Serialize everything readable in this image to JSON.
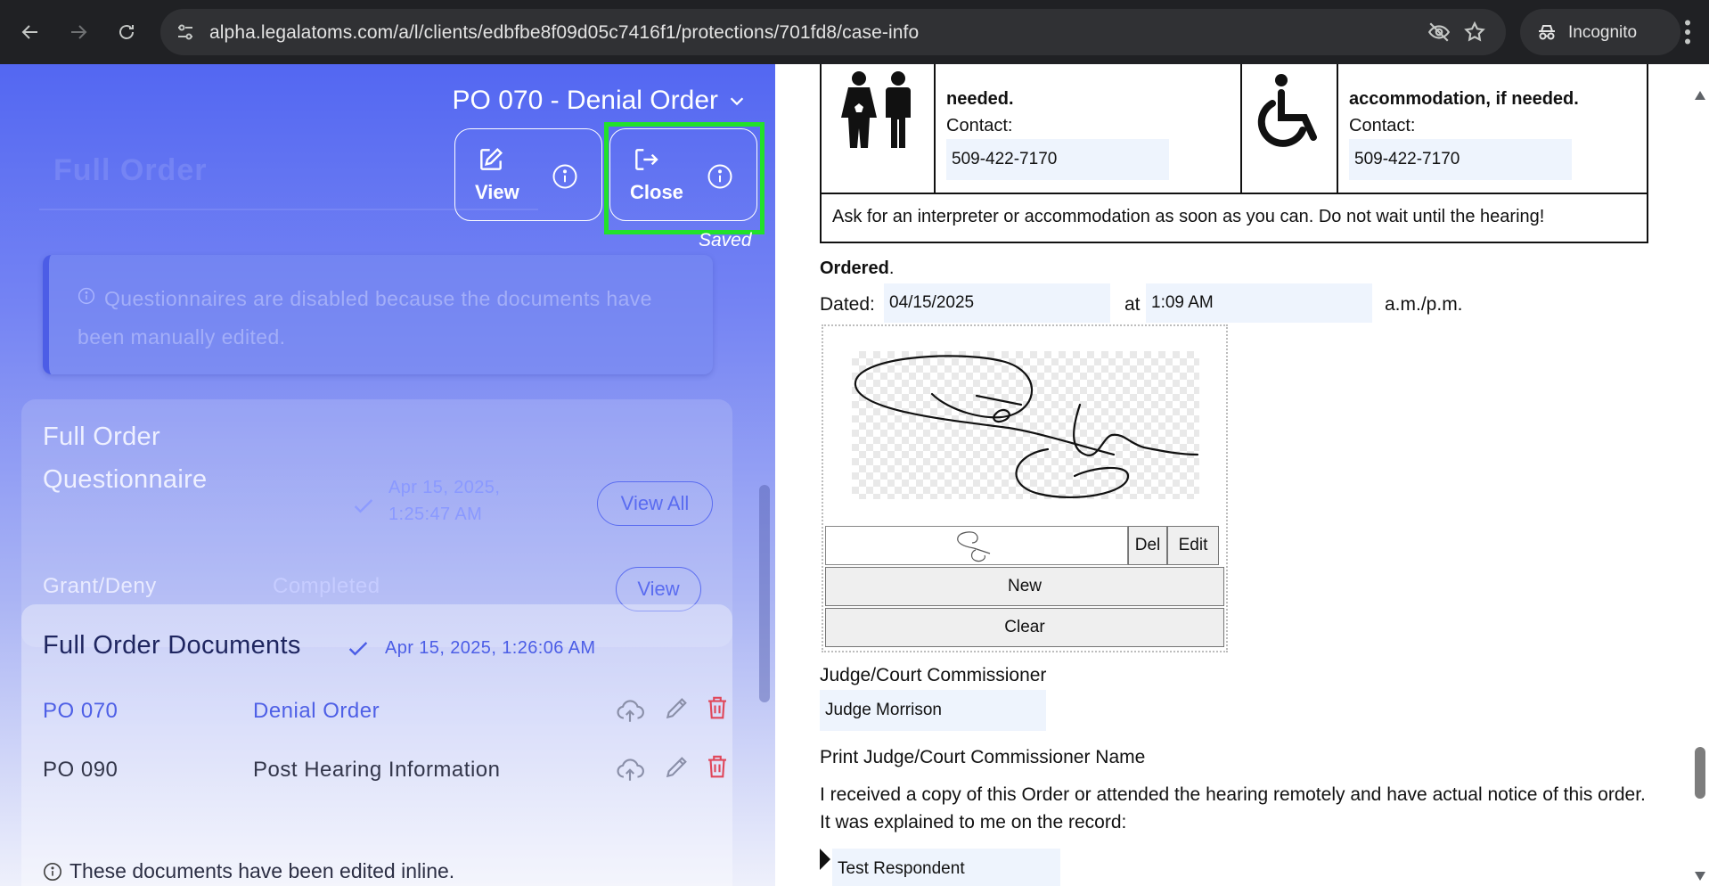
{
  "browser": {
    "url": "alpha.legalatoms.com/a/l/clients/edbfbe8f09d05c7416f1/protections/701fd8/case-info",
    "incognito_label": "Incognito"
  },
  "left": {
    "doc_title": "PO 070 - Denial Order",
    "ghost_title": "Full Order",
    "view_label": "View",
    "close_label": "Close",
    "saved_label": "Saved",
    "notice": "Questionnaires are disabled because the documents have been manually edited.",
    "questionnaire": {
      "title": "Full Order Questionnaire",
      "timestamp": "Apr 15, 2025, 1:25:47 AM",
      "view_all_label": "View All",
      "row_name": "Grant/Deny",
      "row_status": "Completed",
      "view_label": "View"
    },
    "documents": {
      "title": "Full Order Documents",
      "timestamp": "Apr 15, 2025, 1:26:06 AM",
      "rows": [
        {
          "code": "PO 070",
          "name": "Denial Order"
        },
        {
          "code": "PO 090",
          "name": "Post Hearing Information"
        }
      ],
      "edited_note": "These documents have been edited inline."
    }
  },
  "document": {
    "col1_bold": "needed.",
    "col1_contact": "Contact:",
    "col1_phone": "509-422-7170",
    "col2_bold": "accommodation, if needed.",
    "col2_contact": "Contact:",
    "col2_phone": "509-422-7170",
    "table_note": "Ask for an interpreter or accommodation as soon as you can. Do not wait until the hearing!",
    "ordered_bold": "Ordered",
    "ordered_rest": ".",
    "dated_label": "Dated:",
    "dated_value": "04/15/2025",
    "at_label": "at",
    "time_value": "1:09 AM",
    "ampm_label": "a.m./p.m.",
    "sig_del": "Del",
    "sig_edit": "Edit",
    "sig_new": "New",
    "sig_clear": "Clear",
    "judge_label": "Judge/Court Commissioner",
    "judge_value": "Judge Morrison",
    "print_label": "Print Judge/Court Commissioner Name",
    "received_text": "I received a copy of this Order or attended the hearing remotely and have actual notice of this order. It was explained to me on the record:",
    "respondent_value": "Test  Respondent"
  },
  "icons": {
    "back": "arrow-left-icon",
    "forward": "arrow-right-icon",
    "reload": "reload-icon",
    "site": "tune-icon",
    "eye_off": "eye-off-icon",
    "star": "star-icon",
    "incognito": "incognito-icon",
    "menu": "kebab-menu-icon"
  },
  "colors": {
    "accent": "#5367f2",
    "highlight": "#22e12a",
    "delete": "#e0475a"
  }
}
